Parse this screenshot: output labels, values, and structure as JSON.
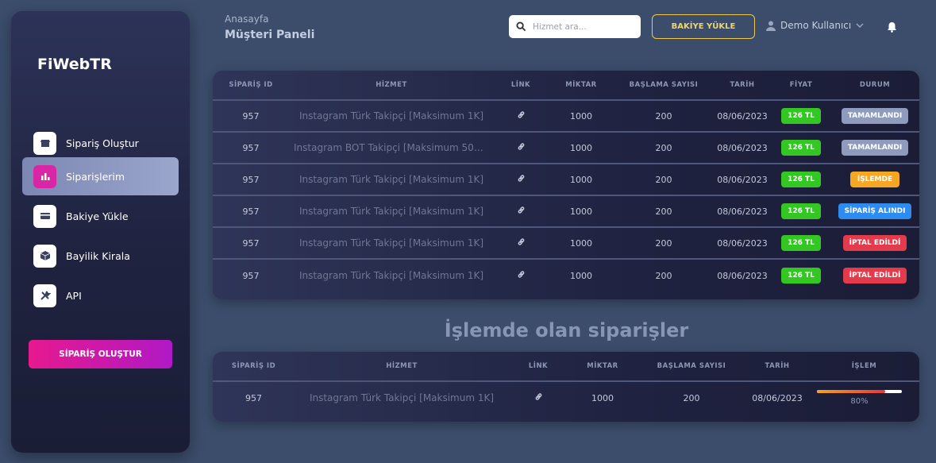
{
  "sidebar": {
    "brand": "FiWebTR",
    "items": [
      {
        "label": "Sipariş Oluştur",
        "icon": "store-icon",
        "active": false
      },
      {
        "label": "Siparişlerim",
        "icon": "chart-icon",
        "active": true
      },
      {
        "label": "Bakiye Yükle",
        "icon": "card-icon",
        "active": false
      },
      {
        "label": "Bayilik Kirala",
        "icon": "box-icon",
        "active": false
      },
      {
        "label": "API",
        "icon": "tools-icon",
        "active": false
      }
    ],
    "cta_label": "SİPARİŞ OLUŞTUR"
  },
  "header": {
    "breadcrumb": "Anasayfa",
    "title": "Müşteri Paneli",
    "search_placeholder": "Hizmet ara...",
    "topup_label": "BAKİYE YÜKLE",
    "user_name": "Demo Kullanıcı"
  },
  "orders": {
    "columns": [
      "SİPARİŞ ID",
      "HİZMET",
      "LİNK",
      "MİKTAR",
      "BAŞLAMA SAYISI",
      "TARİH",
      "FİYAT",
      "DURUM"
    ],
    "rows": [
      {
        "id": "957",
        "service": "Instagram Türk Takipçi [Maksimum 1K]",
        "qty": "1000",
        "start": "200",
        "date": "08/06/2023",
        "price": "126 TL",
        "status": "TAMAMLANDI",
        "status_color": "#8e9bbd"
      },
      {
        "id": "957",
        "service": "Instagram BOT Takipçi [Maksimum 50K]...",
        "qty": "1000",
        "start": "200",
        "date": "08/06/2023",
        "price": "126 TL",
        "status": "TAMAMLANDI",
        "status_color": "#8e9bbd"
      },
      {
        "id": "957",
        "service": "Instagram Türk Takipçi [Maksimum 1K]",
        "qty": "1000",
        "start": "200",
        "date": "08/06/2023",
        "price": "126 TL",
        "status": "İŞLEMDE",
        "status_color": "#f5a623"
      },
      {
        "id": "957",
        "service": "Instagram Türk Takipçi [Maksimum 1K]",
        "qty": "1000",
        "start": "200",
        "date": "08/06/2023",
        "price": "126 TL",
        "status": "SİPARİŞ ALINDI",
        "status_color": "#2e8cf0"
      },
      {
        "id": "957",
        "service": "Instagram Türk Takipçi [Maksimum 1K]",
        "qty": "1000",
        "start": "200",
        "date": "08/06/2023",
        "price": "126 TL",
        "status": "İPTAL EDİLDİ",
        "status_color": "#e43b4c"
      },
      {
        "id": "957",
        "service": "Instagram Türk Takipçi [Maksimum 1K]",
        "qty": "1000",
        "start": "200",
        "date": "08/06/2023",
        "price": "126 TL",
        "status": "İPTAL EDİLDİ",
        "status_color": "#e43b4c"
      }
    ]
  },
  "in_progress": {
    "title": "İşlemde olan siparişler",
    "columns": [
      "SİPARİŞ ID",
      "HİZMET",
      "LİNK",
      "MİKTAR",
      "BAŞLAMA SAYISI",
      "TARİH",
      "İŞLEM"
    ],
    "rows": [
      {
        "id": "957",
        "service": "Instagram Türk Takipçi [Maksimum 1K]",
        "qty": "1000",
        "start": "200",
        "date": "08/06/2023",
        "progress": 80,
        "progress_label": "80%"
      }
    ]
  }
}
